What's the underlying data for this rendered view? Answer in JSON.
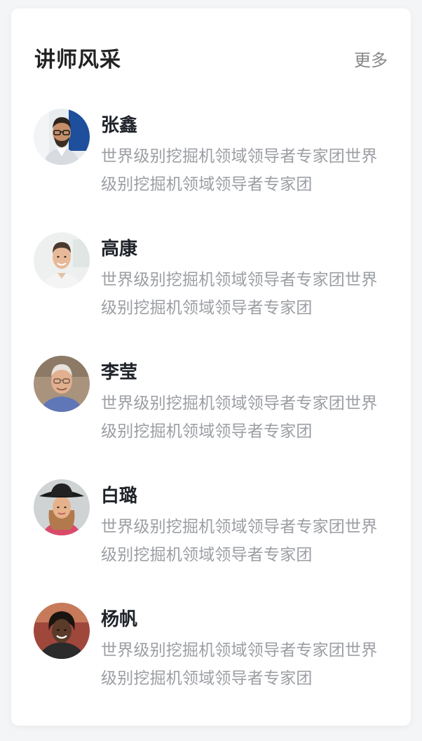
{
  "section": {
    "title": "讲师风采",
    "more_label": "更多"
  },
  "teachers": [
    {
      "name": "张鑫",
      "desc": "世界级别挖掘机领域领导者专家团世界级别挖掘机领域领导者专家团",
      "avatar": "man-with-glasses-beard"
    },
    {
      "name": "高康",
      "desc": "世界级别挖掘机领域领导者专家团世界级别挖掘机领域领导者专家团",
      "avatar": "smiling-young-man"
    },
    {
      "name": "李莹",
      "desc": "世界级别挖掘机领域领导者专家团世界级别挖掘机领域领导者专家团",
      "avatar": "older-man-glasses"
    },
    {
      "name": "白璐",
      "desc": "世界级别挖掘机领域领导者专家团世界级别挖掘机领域领导者专家团",
      "avatar": "woman-with-hat"
    },
    {
      "name": "杨帆",
      "desc": "世界级别挖掘机领域领导者专家团世界级别挖掘机领域领导者专家团",
      "avatar": "smiling-woman"
    }
  ]
}
